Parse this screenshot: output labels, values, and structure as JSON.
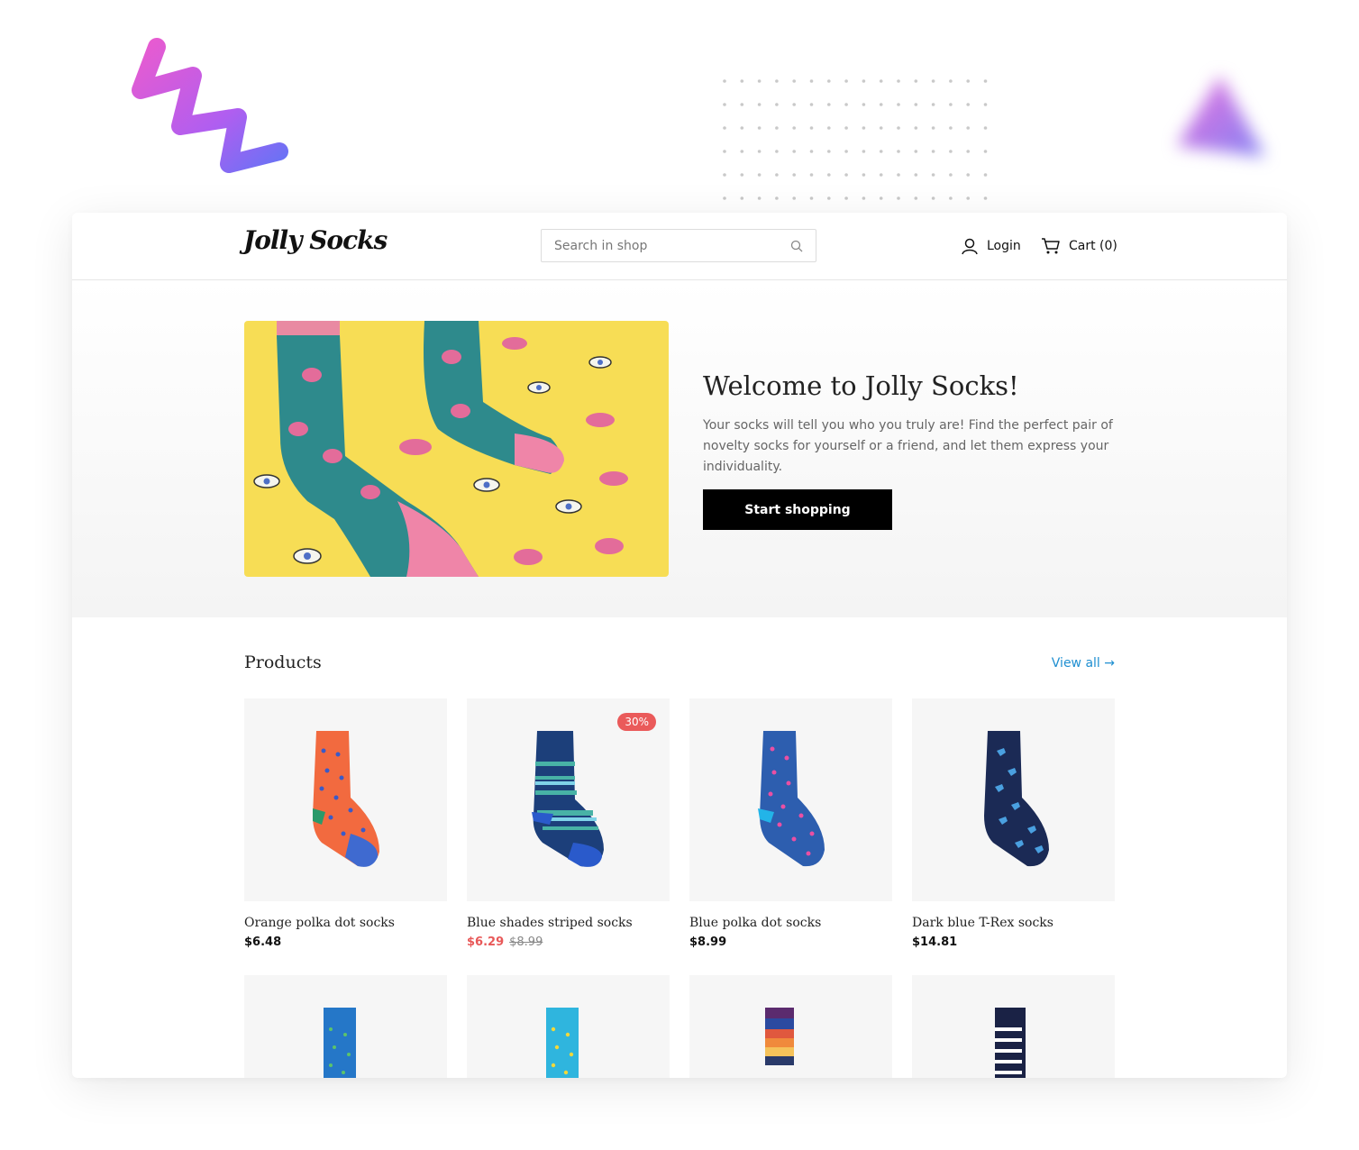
{
  "brand": {
    "logo_text": "Jolly Socks"
  },
  "search": {
    "placeholder": "Search in shop",
    "icon": "search-icon"
  },
  "nav": {
    "login_label": "Login",
    "login_icon": "user-icon",
    "cart_label": "Cart (0)",
    "cart_icon": "cart-icon"
  },
  "hero": {
    "title": "Welcome to Jolly Socks!",
    "text": "Your socks will tell you who you truly are! Find the perfect pair of novelty socks for yourself or a friend, and let them express your individuality.",
    "button_label": "Start shopping"
  },
  "products": {
    "title": "Products",
    "view_all_label": "View all →",
    "items": [
      {
        "name": "Orange polka dot socks",
        "price": "$6.48"
      },
      {
        "name": "Blue shades striped socks",
        "price": "$6.29",
        "old_price": "$8.99",
        "badge": "30%"
      },
      {
        "name": "Blue polka dot socks",
        "price": "$8.99"
      },
      {
        "name": "Dark blue T-Rex socks",
        "price": "$14.81"
      }
    ]
  },
  "colors": {
    "accent_link": "#1f8fd1",
    "sale": "#e85858",
    "button": "#000000",
    "hero_image_bg": "#f7dd55"
  }
}
